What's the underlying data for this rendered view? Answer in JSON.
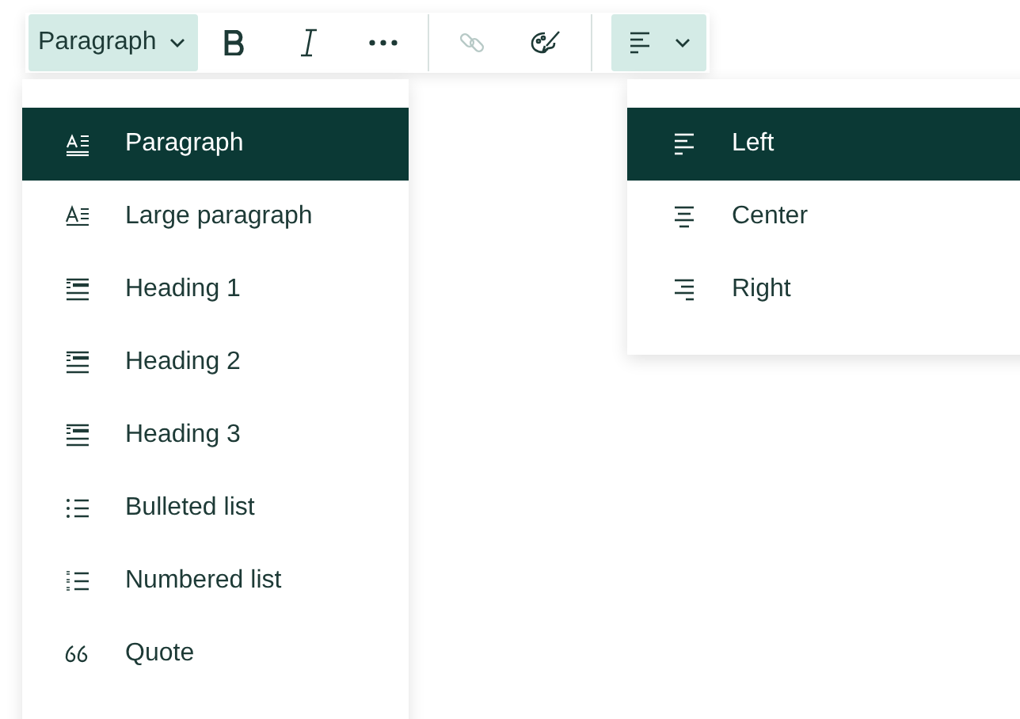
{
  "toolbar": {
    "block_dropdown": {
      "label": "Paragraph",
      "active": true
    },
    "tools": [
      {
        "kind": "bold",
        "disabled": false
      },
      {
        "kind": "italic",
        "disabled": false
      },
      {
        "kind": "more",
        "disabled": false
      },
      {
        "kind": "link",
        "disabled": true
      },
      {
        "kind": "palette",
        "disabled": false
      }
    ],
    "align_dropdown": {
      "kind": "left",
      "active": true
    }
  },
  "block_menu": [
    {
      "label": "Paragraph",
      "kind": "paragraph",
      "selected": true
    },
    {
      "label": "Large paragraph",
      "kind": "large",
      "selected": false
    },
    {
      "label": "Heading 1",
      "kind": "h1",
      "selected": false
    },
    {
      "label": "Heading 2",
      "kind": "h2",
      "selected": false
    },
    {
      "label": "Heading 3",
      "kind": "h3",
      "selected": false
    },
    {
      "label": "Bulleted list",
      "kind": "bullets",
      "selected": false
    },
    {
      "label": "Numbered list",
      "kind": "numbers",
      "selected": false
    },
    {
      "label": "Quote",
      "kind": "quote",
      "selected": false
    }
  ],
  "align_menu": [
    {
      "label": "Left",
      "kind": "left",
      "selected": true
    },
    {
      "label": "Center",
      "kind": "center",
      "selected": false
    },
    {
      "label": "Right",
      "kind": "right",
      "selected": false
    }
  ]
}
